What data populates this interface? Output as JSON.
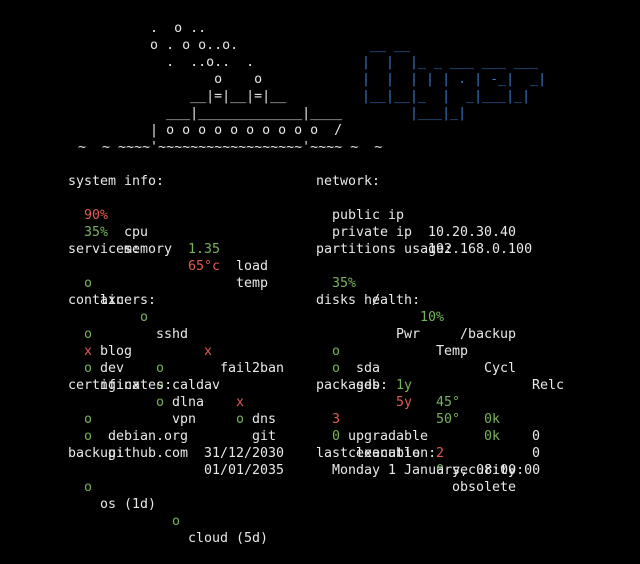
{
  "art": {
    "lines": [
      "          .  o ..",
      "          o . o o..o.",
      "            .  ..o..  .",
      "                  o    o",
      "               __|=|__|=|__",
      "            ___|_____________|____",
      "          | o o o o o o o o o o  /",
      " ~  ~ ~~~~'~~~~~~~~~~~~~~~~~~'~~~~ ~  ~"
    ],
    "logo_lines": [
      "   __ __",
      "  |  |  |_ _ ___ ___ ___",
      "  |  |  | | | . | -_|  _|",
      "  |__|__|_  |  _|___|_|",
      "        |___|_|"
    ]
  },
  "colors": {
    "red": "#e05a52",
    "green": "#78b45a",
    "blue": "#3b78c8"
  },
  "system": {
    "title": "system info:",
    "cpu_val": "90%",
    "cpu_label": "cpu",
    "load_val": "1.35",
    "load_label": "load",
    "mem_val": "35%",
    "mem_label": "memory",
    "temp_val": "65°c",
    "temp_label": "temp"
  },
  "network": {
    "title": "network:",
    "public_label": "public ip",
    "public_val": "10.20.30.40",
    "private_label": "private ip",
    "private_val": "192.168.0.100"
  },
  "services": {
    "title": "services:",
    "items": [
      {
        "mark": "o",
        "name": "lxc",
        "status": "ok"
      },
      {
        "mark": "o",
        "name": "sshd",
        "status": "ok"
      },
      {
        "mark": "x",
        "name": "fail2ban",
        "status": "fail"
      }
    ]
  },
  "partitions": {
    "title": "partitions usage:",
    "items": [
      {
        "pct": "35%",
        "mount": "/"
      },
      {
        "pct": "10%",
        "mount": "/backup"
      }
    ]
  },
  "containers": {
    "title": "containers:",
    "rows": [
      [
        {
          "mark": "o",
          "name": "blog"
        },
        {
          "mark": "o",
          "name": "caldav"
        },
        {
          "mark": "x",
          "name": "dns"
        }
      ],
      [
        {
          "mark": "x",
          "name": "dev"
        },
        {
          "mark": "o",
          "name": "dlna"
        },
        {
          "mark": "o",
          "name": "git"
        }
      ],
      [
        {
          "mark": "o",
          "name": "nginx"
        },
        {
          "mark": "o",
          "name": "vpn"
        }
      ]
    ]
  },
  "disks": {
    "title": "disks health:",
    "headers": {
      "pwr": "Pwr",
      "temp": "Temp",
      "cycl": "Cycl",
      "relc": "Relc"
    },
    "rows": [
      {
        "mark": "o",
        "name": "sda",
        "pwr": "1y",
        "temp": "45°",
        "cycl": "0k",
        "relc": "0"
      },
      {
        "mark": "o",
        "name": "sdb",
        "pwr": "5y",
        "temp": "50°",
        "cycl": "0k",
        "relc": "0"
      }
    ]
  },
  "certificates": {
    "title": "certificates:",
    "items": [
      {
        "mark": "o",
        "domain": "debian.org",
        "date": "31/12/2030"
      },
      {
        "mark": "o",
        "domain": "github.com",
        "date": "01/01/2035"
      }
    ]
  },
  "packages": {
    "title": "packages:",
    "upgradable_n": "3",
    "upgradable_label": "upgradable",
    "security_n": "2",
    "security_label": "security",
    "cleanable_n": "0",
    "cleanable_label": "cleanable",
    "obsolete_n": "0",
    "obsolete_label": "obsolete"
  },
  "backup": {
    "title": "backup:",
    "items": [
      {
        "mark": "o",
        "label": "os (1d)"
      },
      {
        "mark": "o",
        "label": "cloud (5d)"
      }
    ]
  },
  "last_execution": {
    "title": "last execution:",
    "value": "Monday 1 January, 08:00:00"
  }
}
